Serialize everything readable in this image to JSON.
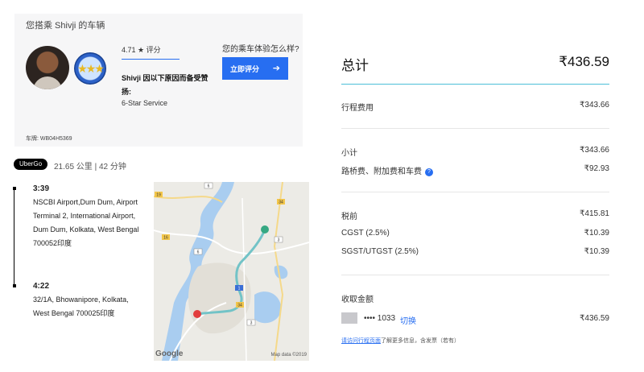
{
  "driver_card": {
    "title": "您搭乘 Shivji 的车辆",
    "rating": "4.71 ★ 评分",
    "compliment": "Shivji 因以下原因而备受赞扬:",
    "service": "6-Star Service",
    "question": "您的乘车体验怎么样?",
    "rate_button": "立即评分",
    "plate": "车牌:  WB04H5369"
  },
  "trip": {
    "product": "UberGo",
    "meta": "21.65 公里 | 42 分钟",
    "pickup": {
      "time": "3:39",
      "address": "NSCBI Airport,Dum Dum, Airport Terminal 2, International Airport, Dum Dum, Kolkata, West Bengal 700052印度"
    },
    "dropoff": {
      "time": "4:22",
      "address": "32/1A, Bhowanipore, Kolkata, West Bengal 700025印度"
    }
  },
  "map": {
    "google_label": "Google",
    "attribution": "Map data ©2019",
    "shields": [
      "19",
      "6",
      "34",
      "16",
      "6",
      "3",
      "1",
      "34",
      "3"
    ],
    "route_color": "#72c3c7",
    "pickup_color": "#36a882",
    "dropoff_color": "#e23d3d"
  },
  "receipt": {
    "total_label": "总计",
    "total_value": "₹436.59",
    "trip_fare_label": "行程费用",
    "trip_fare_value": "₹343.66",
    "subtotal_label": "小计",
    "subtotal_value": "₹343.66",
    "tolls_label": "路桥费、附加费和车费",
    "tolls_value": "₹92.93",
    "pretax_label": "税前",
    "pretax_value": "₹415.81",
    "cgst_label": "CGST (2.5%)",
    "cgst_value": "₹10.39",
    "sgst_label": "SGST/UTGST (2.5%)",
    "sgst_value": "₹10.39",
    "charged_label": "收取金额",
    "card_number": "•••• 1033",
    "switch_label": "切换",
    "charged_value": "₹436.59",
    "footer_link": "请访问行程页面",
    "footer_text": "了解更多信息，含发票（若有）",
    "accent_color": "#276ef1"
  }
}
